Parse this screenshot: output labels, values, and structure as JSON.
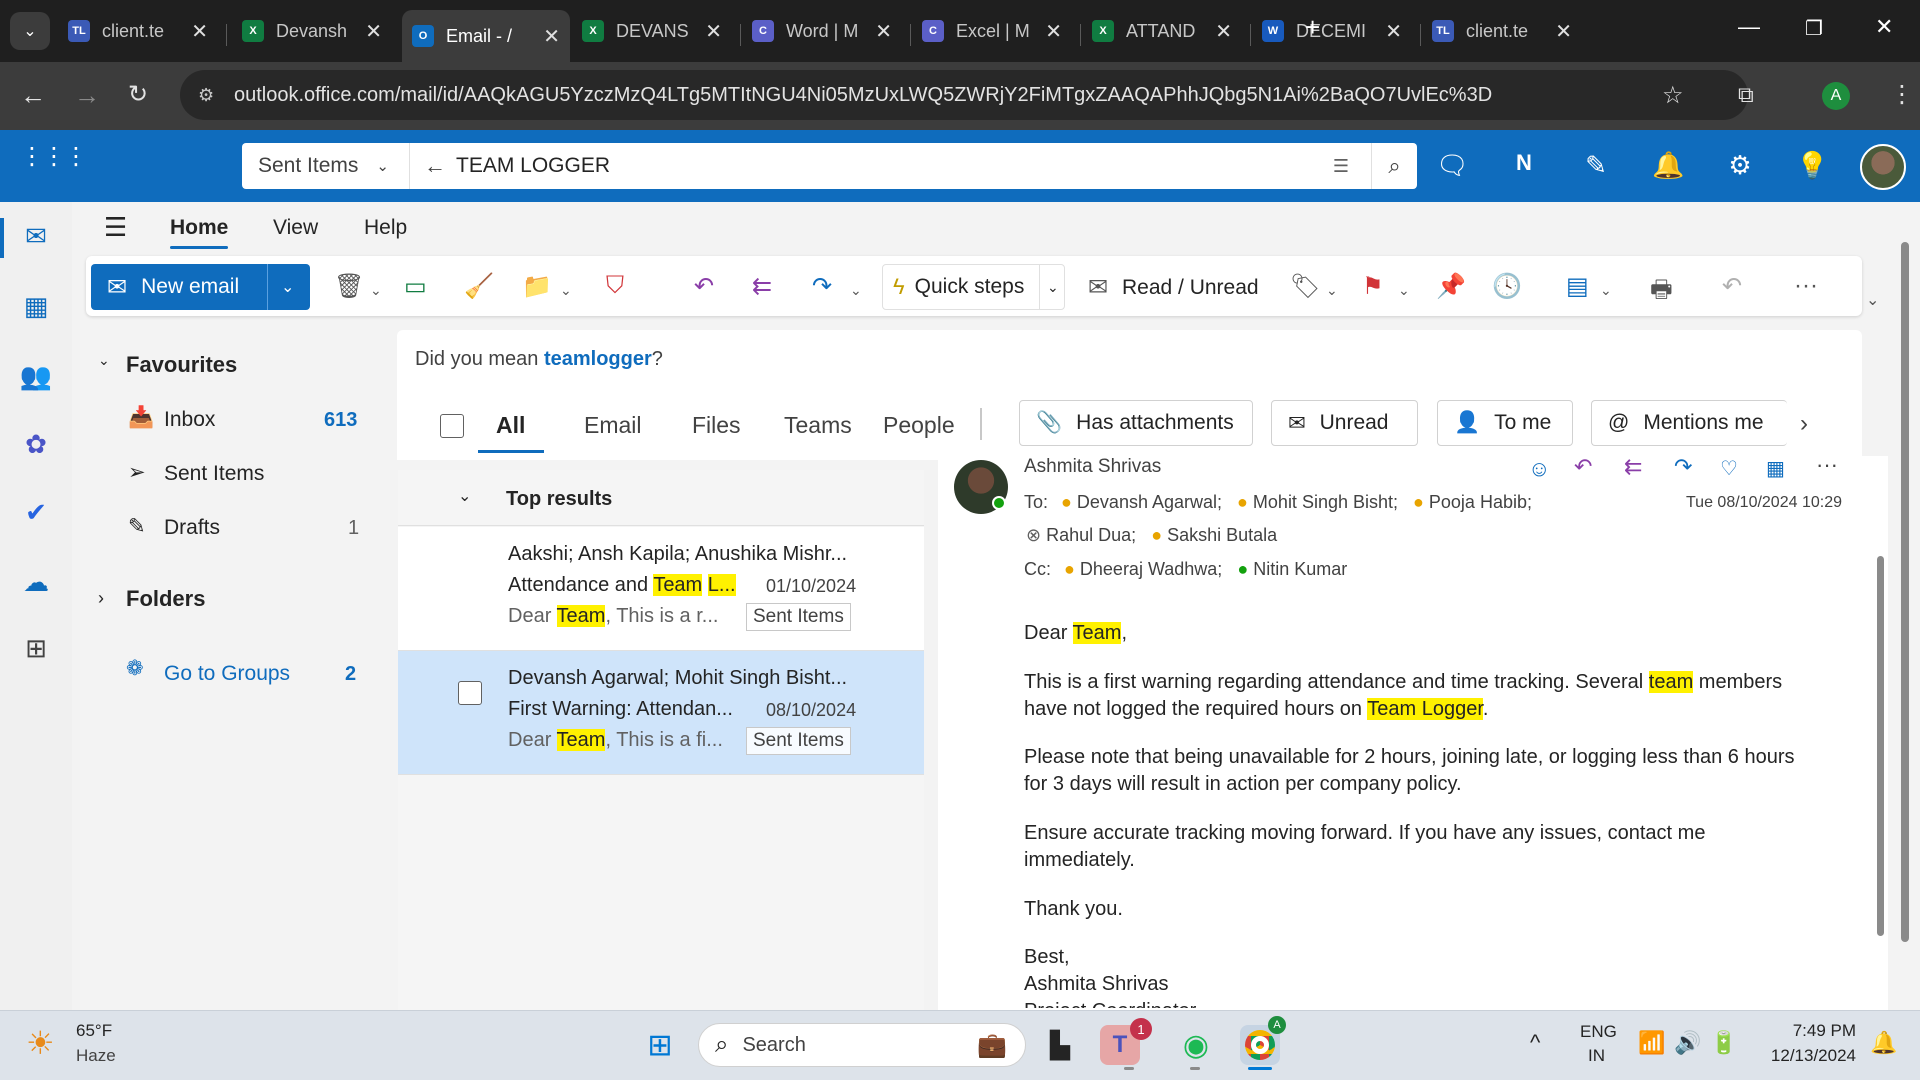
{
  "browser": {
    "tabs": [
      {
        "icon": "TL",
        "icon_color": "#3b5ab6",
        "title": "client.te"
      },
      {
        "icon": "X",
        "icon_color": "#107c41",
        "title": "Devansh"
      },
      {
        "icon": "O",
        "icon_color": "#0f6cbd",
        "title": "Email - /"
      },
      {
        "icon": "X",
        "icon_color": "#107c41",
        "title": "DEVANS"
      },
      {
        "icon": "C",
        "icon_color": "#5b5fc7",
        "title": "Word | M"
      },
      {
        "icon": "C",
        "icon_color": "#5b5fc7",
        "title": "Excel | M"
      },
      {
        "icon": "X",
        "icon_color": "#107c41",
        "title": "ATTAND"
      },
      {
        "icon": "W",
        "icon_color": "#185abd",
        "title": "DECEMI"
      },
      {
        "icon": "TL",
        "icon_color": "#3b5ab6",
        "title": "client.te"
      }
    ],
    "url": "outlook.office.com/mail/id/AAQkAGU5YzczMzQ4LTg5MTItNGU4Ni05MzUxLWQ5ZWRjY2FiMTgxZAAQAPhhJQbg5N1Ai%2BaQO7UvlEc%3D",
    "profile_initial": "A"
  },
  "outlook": {
    "search_scope": "Sent Items",
    "search_query": "TEAM LOGGER",
    "menu": [
      "Home",
      "View",
      "Help"
    ],
    "ribbon": {
      "new_email": "New email",
      "quick_steps": "Quick steps",
      "read_unread": "Read / Unread"
    },
    "folders": {
      "favourites": "Favourites",
      "inbox": "Inbox",
      "inbox_count": "613",
      "sent": "Sent Items",
      "drafts": "Drafts",
      "drafts_count": "1",
      "folders": "Folders",
      "groups": "Go to Groups",
      "groups_count": "2"
    },
    "did_you_mean_prefix": "Did you mean ",
    "did_you_mean_term": "teamlogger",
    "did_you_mean_suffix": "?",
    "tabs": [
      "All",
      "Email",
      "Files",
      "Teams",
      "People"
    ],
    "filters": [
      "Has attachments",
      "Unread",
      "To me",
      "Mentions me"
    ],
    "top_results": "Top results",
    "results": [
      {
        "from": "Aakshi; Ansh Kapila; Anushika Mishr...",
        "subject_pre": "Attendance and ",
        "subject_hl1": "Team",
        "subject_sp": " ",
        "subject_hl2": "L...",
        "date": "01/10/2024",
        "preview_pre": "Dear ",
        "preview_hl": "Team",
        "preview_post": ", This is a r...",
        "folder": "Sent Items"
      },
      {
        "from": "Devansh Agarwal; Mohit Singh Bisht...",
        "subject": "First Warning: Attendan...",
        "date": "08/10/2024",
        "preview_pre": "Dear ",
        "preview_hl": "Team",
        "preview_post": ", This is a fi...",
        "folder": "Sent Items"
      }
    ],
    "email": {
      "sender": "Ashmita Shrivas",
      "to_label": "To:",
      "to": [
        "Devansh Agarwal;",
        "Mohit Singh Bisht;",
        "Pooja Habib;",
        "Rahul Dua;",
        "Sakshi Butala"
      ],
      "cc_label": "Cc:",
      "cc": [
        "Dheeraj Wadhwa;",
        "Nitin Kumar"
      ],
      "date": "Tue 08/10/2024 10:29",
      "greeting_pre": "Dear ",
      "greeting_hl": "Team",
      "greeting_post": ",",
      "p1_a": "This is a first warning regarding attendance and time tracking. Several ",
      "p1_hl": "team",
      "p1_b": " members",
      "p1_line2_pre": "have not logged the required hours on ",
      "p1_hl2": "Team",
      "p1_sp": " ",
      "p1_hl3": "Logger",
      "p1_end": ".",
      "p2_l1": "Please note that being unavailable for 2 hours, joining late, or logging less than 6 hours",
      "p2_l2": "for 3 days will result in action per company policy.",
      "p3_l1": "Ensure accurate tracking moving forward. If you have any issues, contact me",
      "p3_l2": "immediately.",
      "thanks": "Thank you.",
      "best": "Best,",
      "sign": "Ashmita Shrivas",
      "sign_cut": "Project Coordinator"
    }
  },
  "taskbar": {
    "weather_temp": "65°F",
    "weather_desc": "Haze",
    "search": "Search",
    "teams_badge": "1",
    "chrome_badge": "A",
    "lang1": "ENG",
    "lang2": "IN",
    "time": "7:49 PM",
    "date": "12/13/2024"
  }
}
